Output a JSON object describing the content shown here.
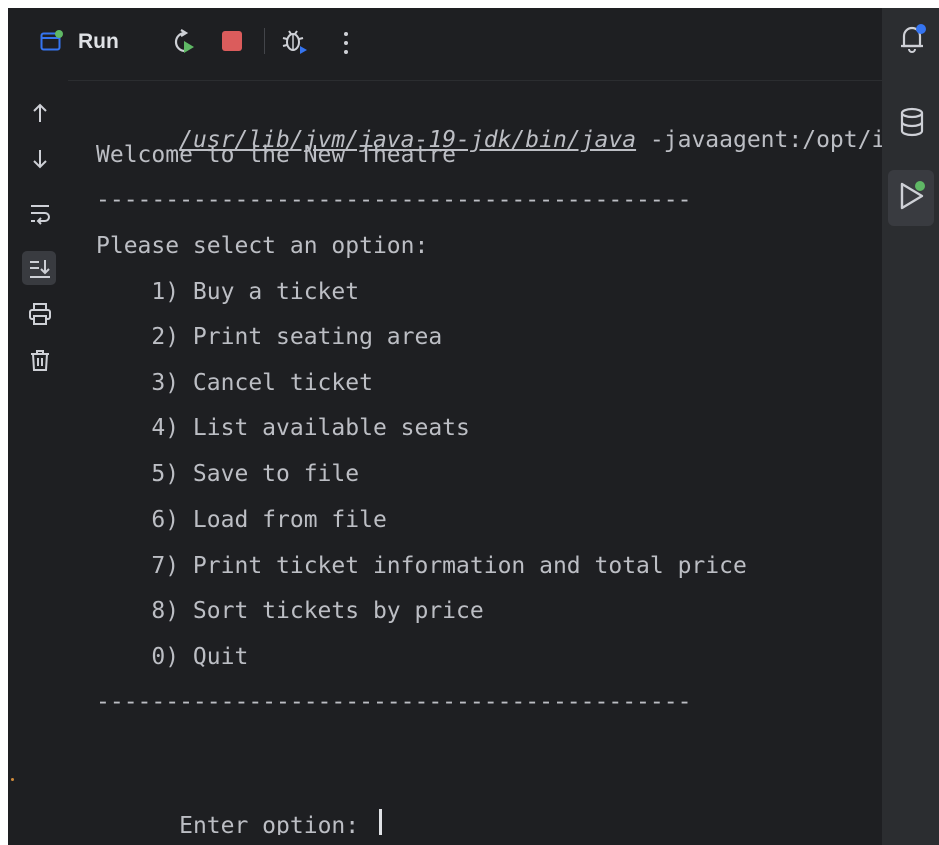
{
  "toolbar": {
    "run_label": "Run",
    "icons": [
      "run-console-icon",
      "rerun-icon",
      "stop-icon",
      "debug-icon",
      "more-icon"
    ]
  },
  "gutter": {
    "icons": [
      "arrow-up-icon",
      "arrow-down-icon",
      "soft-wrap-icon",
      "scroll-to-end-icon",
      "print-icon",
      "trash-icon"
    ]
  },
  "right_strip": {
    "icons": [
      "notifications-icon",
      "database-icon",
      "run-tool-window-icon"
    ]
  },
  "console": {
    "command_path": "/usr/lib/jvm/java-19-jdk/bin/java",
    "command_args": " -javaagent:/opt/i",
    "welcome": "Welcome to the New Theatre",
    "separator": "-------------------------------------------",
    "prompt_header": "Please select an option:",
    "options": [
      "    1) Buy a ticket",
      "    2) Print seating area",
      "    3) Cancel ticket",
      "    4) List available seats",
      "    5) Save to file",
      "    6) Load from file",
      "    7) Print ticket information and total price",
      "    8) Sort tickets by price",
      "    0) Quit"
    ],
    "separator_end": "-------------------------------------------",
    "input_prompt": "Enter option: "
  },
  "colors": {
    "background": "#1e1f22",
    "stop": "#db5c5c",
    "run_green": "#5fb865",
    "accent_blue": "#3574f0",
    "badge_green": "#5fb865"
  }
}
